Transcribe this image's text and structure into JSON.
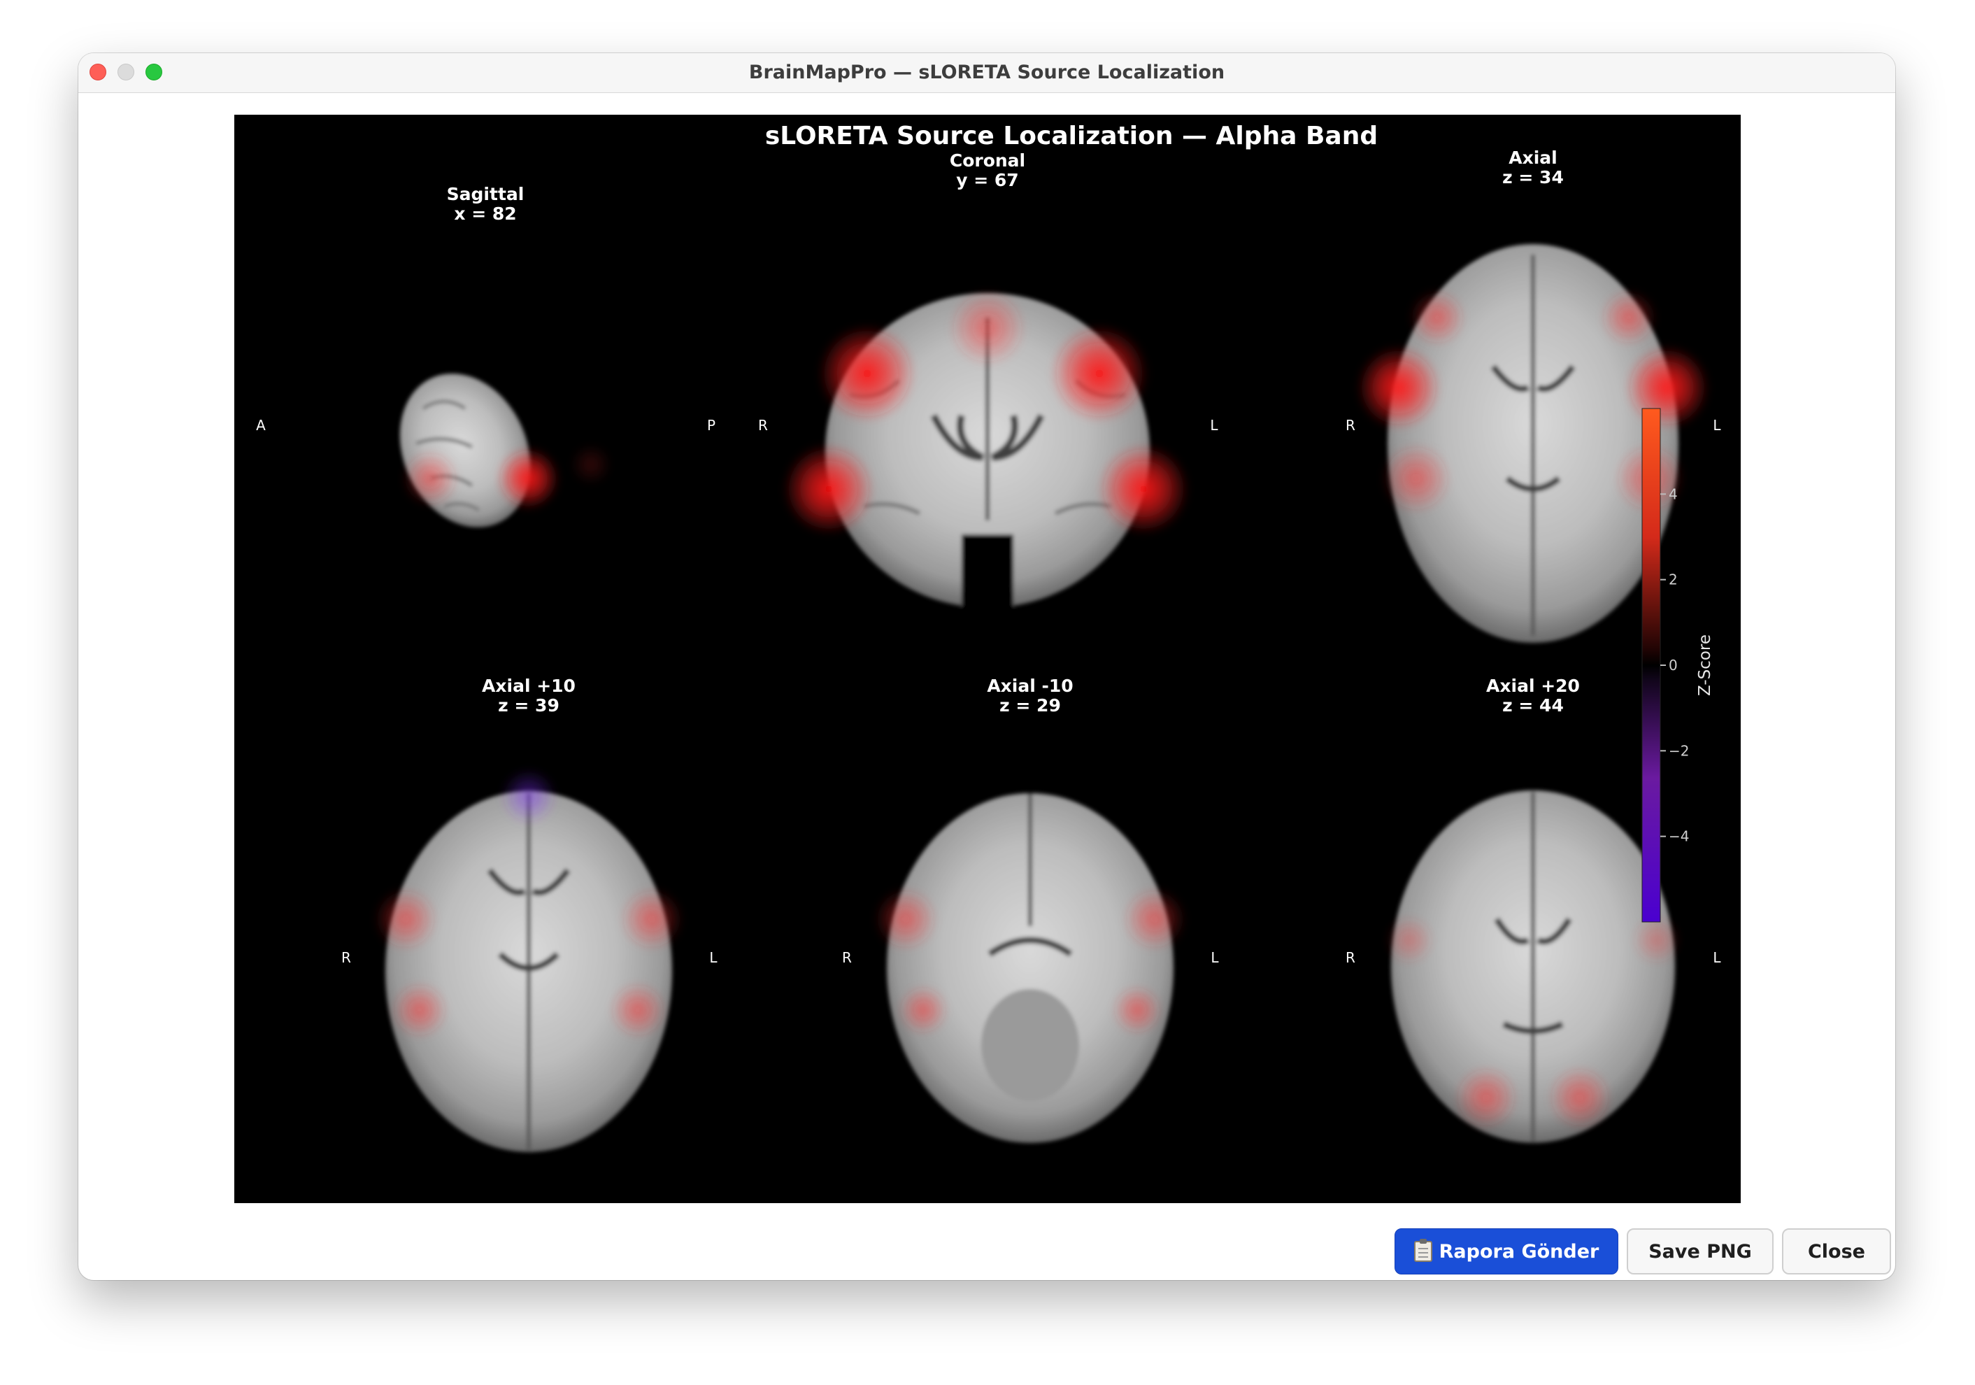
{
  "window": {
    "title": "BrainMapPro — sLORETA Source Localization"
  },
  "figure": {
    "title": "sLORETA Source Localization — Alpha Band",
    "panels": [
      {
        "title": "Sagittal",
        "coord": "x = 82",
        "left_label": "A",
        "right_label": "P"
      },
      {
        "title": "Coronal",
        "coord": "y = 67",
        "left_label": "R",
        "right_label": "L"
      },
      {
        "title": "Axial",
        "coord": "z = 34",
        "left_label": "R",
        "right_label": "L"
      },
      {
        "title": "Axial +10",
        "coord": "z = 39",
        "left_label": "R",
        "right_label": "L"
      },
      {
        "title": "Axial -10",
        "coord": "z = 29",
        "left_label": "R",
        "right_label": "L"
      },
      {
        "title": "Axial +20",
        "coord": "z = 44",
        "left_label": "R",
        "right_label": "L"
      }
    ],
    "colorbar": {
      "label": "Z-Score",
      "ticks": [
        "4",
        "2",
        "0",
        "−2",
        "−4"
      ],
      "range": [
        -6,
        6
      ],
      "colors": {
        "top": "#ff5a1e",
        "mid": "#000000",
        "bottom": "#4a00d0"
      }
    }
  },
  "buttons": {
    "report": "Rapora Gönder",
    "save": "Save PNG",
    "close": "Close"
  },
  "colors": {
    "accent": "#1a4fd8",
    "activation": "#ff2020"
  }
}
